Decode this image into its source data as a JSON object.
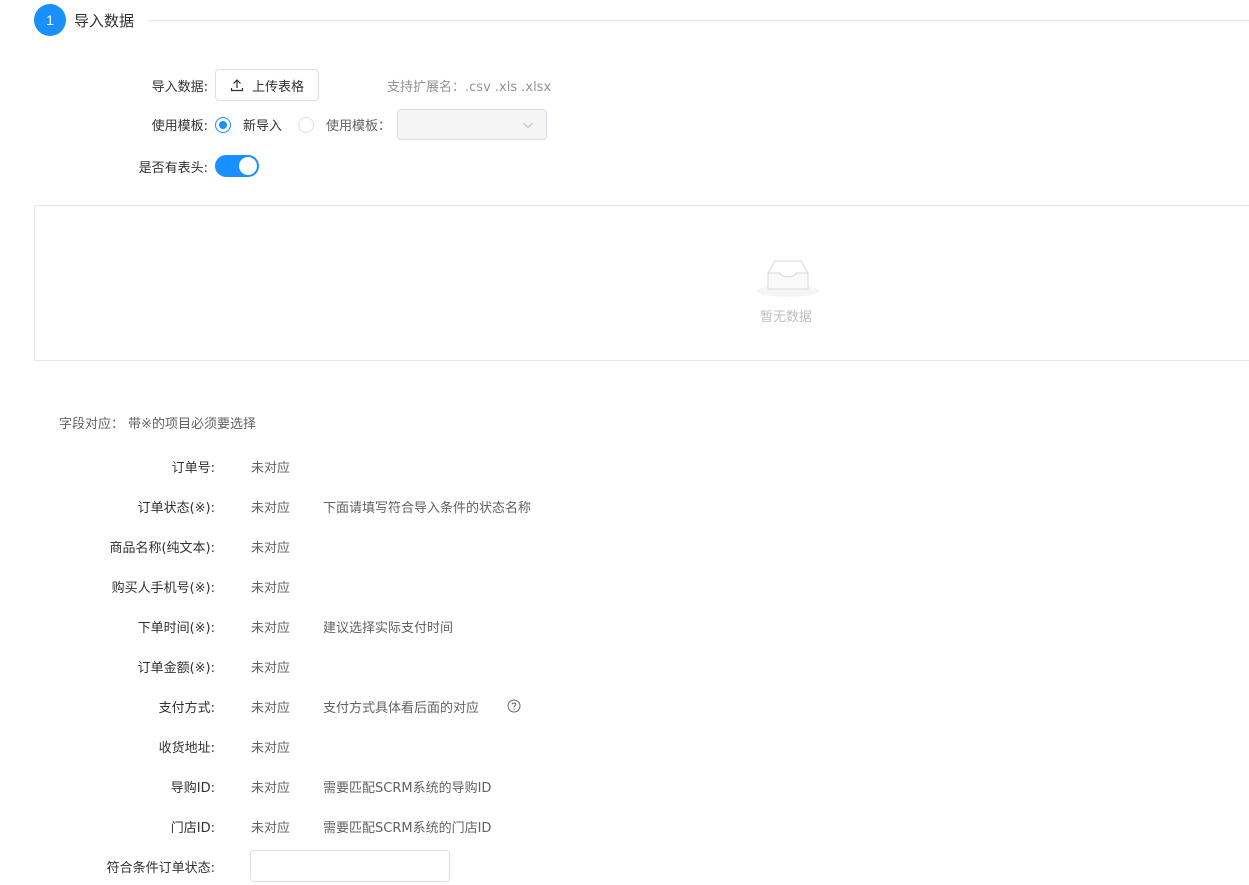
{
  "step": {
    "number": "1",
    "title": "导入数据"
  },
  "import": {
    "label": "导入数据:",
    "upload_button": "上传表格",
    "hint": "支持扩展名：.csv .xls .xlsx"
  },
  "template": {
    "label": "使用模板:",
    "options": [
      {
        "label": "新导入",
        "checked": true
      },
      {
        "label": "使用模板：",
        "checked": false
      }
    ],
    "select_value": ""
  },
  "header_toggle": {
    "label": "是否有表头:",
    "on": true
  },
  "table": {
    "empty_text": "暂无数据"
  },
  "mapping": {
    "title": "字段对应：  带※的项目必须要选择",
    "fields": [
      {
        "label": "订单号:",
        "value": "未对应",
        "hint": ""
      },
      {
        "label": "订单状态(※):",
        "value": "未对应",
        "hint": "下面请填写符合导入条件的状态名称"
      },
      {
        "label": "商品名称(纯文本):",
        "value": "未对应",
        "hint": ""
      },
      {
        "label": "购买人手机号(※):",
        "value": "未对应",
        "hint": ""
      },
      {
        "label": "下单时间(※):",
        "value": "未对应",
        "hint": "建议选择实际支付时间"
      },
      {
        "label": "订单金额(※):",
        "value": "未对应",
        "hint": ""
      },
      {
        "label": "支付方式:",
        "value": "未对应",
        "hint": "支付方式具体看后面的对应"
      },
      {
        "label": "收货地址:",
        "value": "未对应",
        "hint": ""
      },
      {
        "label": "导购ID:",
        "value": "未对应",
        "hint": "需要匹配SCRM系统的导购ID"
      },
      {
        "label": "门店ID:",
        "value": "未对应",
        "hint": "需要匹配SCRM系统的门店ID"
      }
    ],
    "order_status": {
      "label": "符合条件订单状态:",
      "value": ""
    }
  },
  "colors": {
    "accent": "#1890ff",
    "border": "#dcdfe6",
    "muted": "#909399"
  }
}
